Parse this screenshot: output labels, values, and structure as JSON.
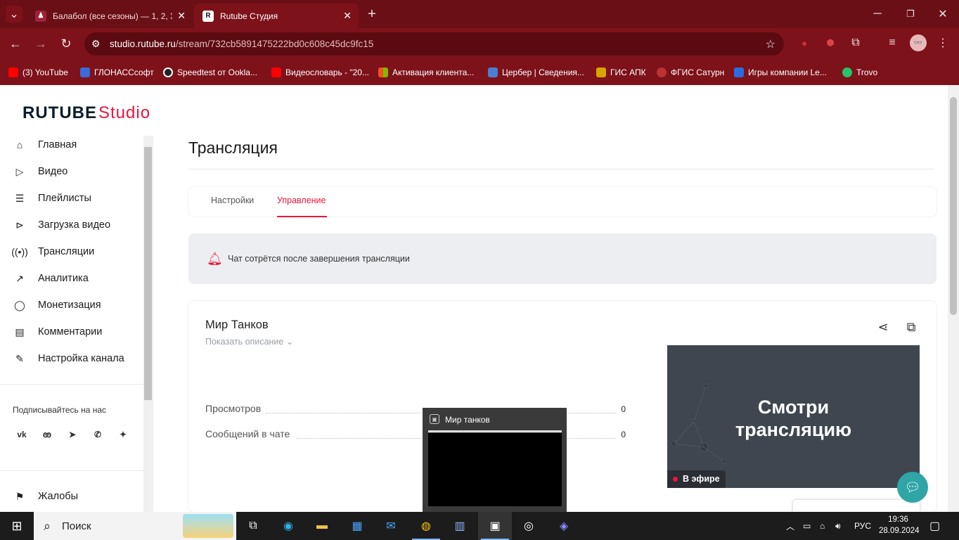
{
  "browser": {
    "tabs": [
      {
        "title": "Балабол (все сезоны) — 1, 2, 3",
        "icon": "rutube-fav-icon"
      },
      {
        "title": "Rutube Студия",
        "icon": "rutube-r-icon"
      }
    ],
    "new_tab": "+",
    "url_host": "studio.rutube.ru",
    "url_path": "/stream/732cb5891475222bd0c608c45dc9fc15",
    "bookmarks": [
      {
        "label": "(3) YouTube",
        "color": "#ff0000"
      },
      {
        "label": "ГЛОНАССсофт",
        "color": "#3a6bd6"
      },
      {
        "label": "Speedtest от Ookla...",
        "color": "#222222"
      },
      {
        "label": "Видеословарь - \"20...",
        "color": "#ff0000"
      },
      {
        "label": "Активация клиента...",
        "color": "#f25022"
      },
      {
        "label": "Цербер | Сведения...",
        "color": "#4a7fd0"
      },
      {
        "label": "ГИС АПК",
        "color": "#d8a400"
      },
      {
        "label": "ФГИС Сатурн",
        "color": "#b33"
      },
      {
        "label": "Игры компании Le...",
        "color": "#2d6cdf"
      },
      {
        "label": "Trovo",
        "color": "#27c46b"
      }
    ]
  },
  "studio": {
    "logo_main": "RUTUBE",
    "logo_sub": "Studio",
    "sidebar": [
      {
        "label": "Главная",
        "icon": "home-icon"
      },
      {
        "label": "Видео",
        "icon": "video-icon"
      },
      {
        "label": "Плейлисты",
        "icon": "playlist-icon"
      },
      {
        "label": "Загрузка видео",
        "icon": "upload-icon"
      },
      {
        "label": "Трансляции",
        "icon": "broadcast-icon"
      },
      {
        "label": "Аналитика",
        "icon": "analytics-icon"
      },
      {
        "label": "Монетизация",
        "icon": "monetization-icon"
      },
      {
        "label": "Комментарии",
        "icon": "comments-icon"
      },
      {
        "label": "Настройка канала",
        "icon": "channel-settings-icon"
      }
    ],
    "follow_label": "Подписывайтесь на нас",
    "socials": [
      "vk-icon",
      "ok-icon",
      "telegram-icon",
      "viber-icon",
      "dzen-icon"
    ],
    "complaints": "Жалобы",
    "page_title": "Трансляция",
    "tabs": [
      "Настройки",
      "Управление"
    ],
    "active_tab": "Управление",
    "notice": "Чат сотрётся после завершения трансляции",
    "stream": {
      "title": "Мир Танков",
      "show_description": "Показать описание",
      "stats": [
        {
          "label": "Просмотров",
          "value": "0"
        },
        {
          "label": "Сообщений в чате",
          "value": "0"
        }
      ],
      "preview_text_line1": "Смотри",
      "preview_text_line2": "трансляцию",
      "live_badge": "В эфире"
    },
    "accent_color": "#ed143b"
  },
  "thumbnail": {
    "title": "Мир танков"
  },
  "taskbar": {
    "search_label": "Поиск",
    "language": "РУС",
    "time": "19:36",
    "date": "28.09.2024"
  }
}
